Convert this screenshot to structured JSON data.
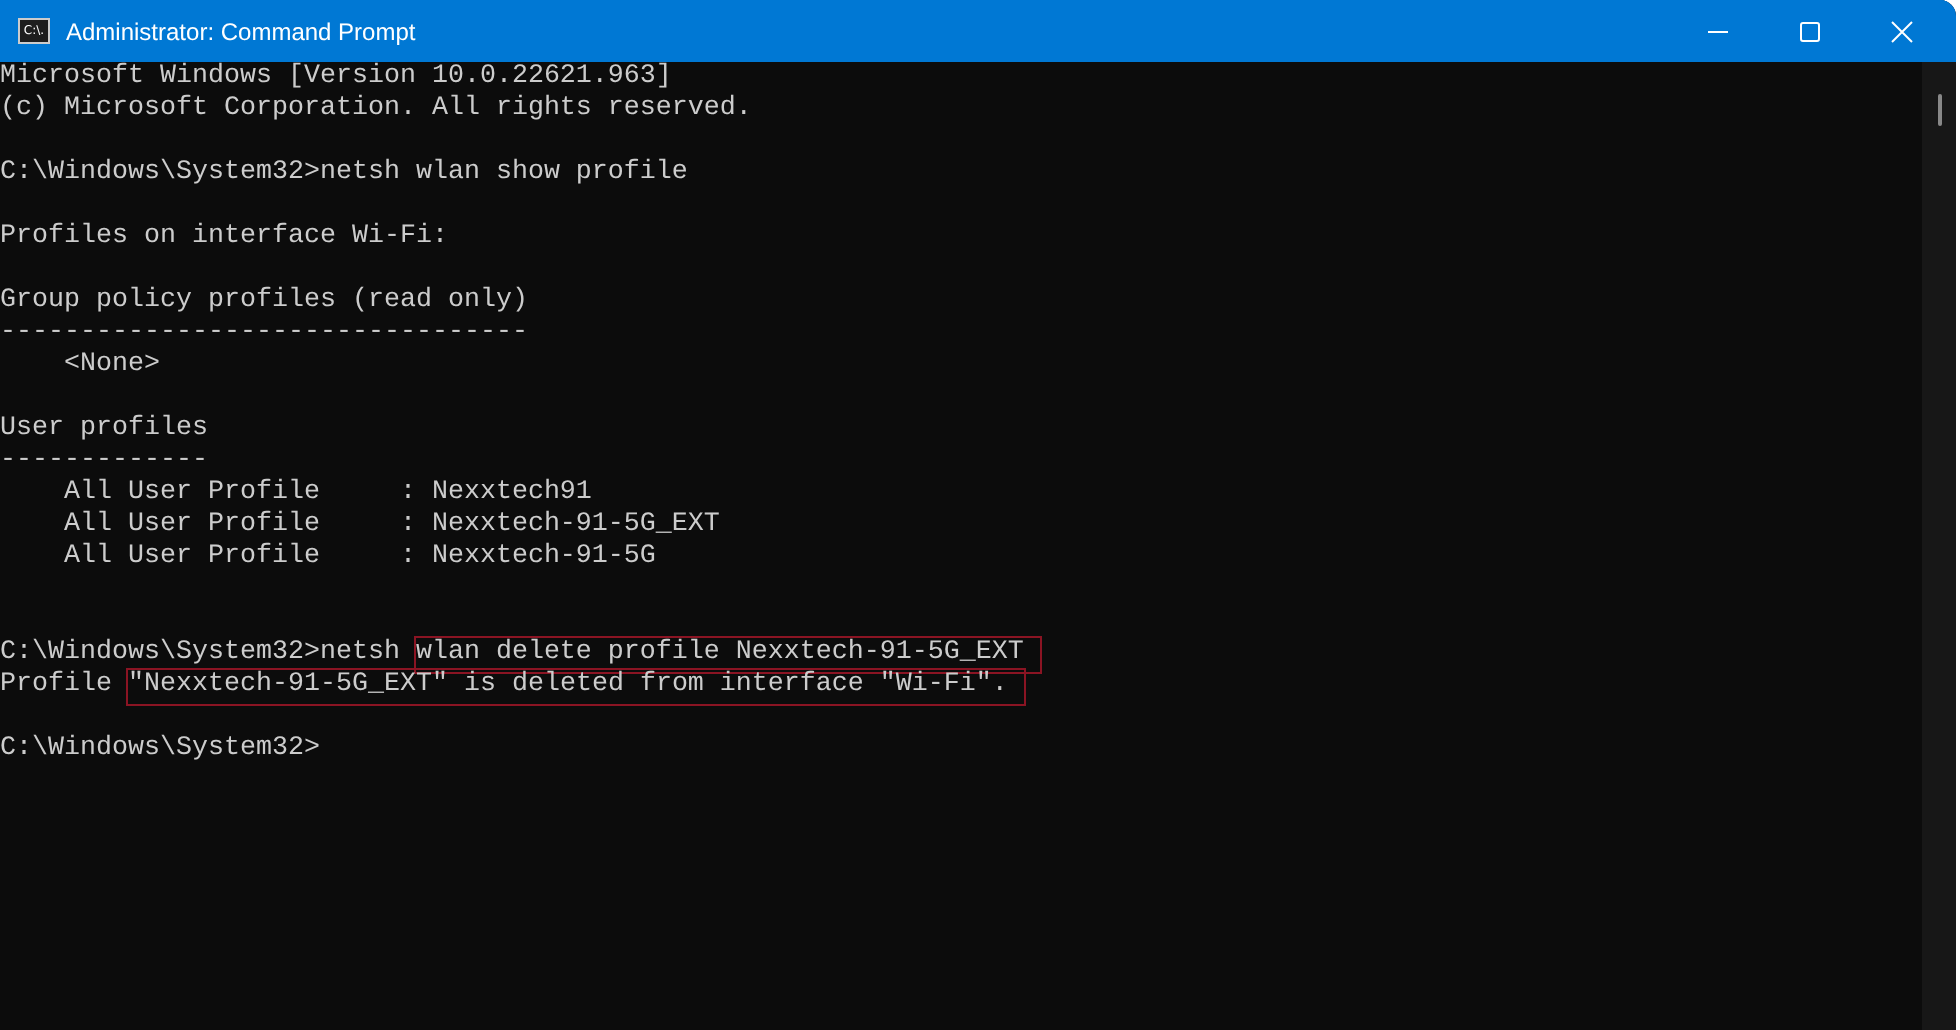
{
  "window": {
    "title": "Administrator: Command Prompt",
    "icon_text": "C:\\."
  },
  "console": {
    "lines": [
      {
        "kind": "text",
        "text": "Microsoft Windows [Version 10.0.22621.963]"
      },
      {
        "kind": "text",
        "text": "(c) Microsoft Corporation. All rights reserved."
      },
      {
        "kind": "blank"
      },
      {
        "kind": "text",
        "text": "C:\\Windows\\System32>netsh wlan show profile"
      },
      {
        "kind": "blank"
      },
      {
        "kind": "text",
        "text": "Profiles on interface Wi-Fi:"
      },
      {
        "kind": "blank"
      },
      {
        "kind": "text",
        "text": "Group policy profiles (read only)"
      },
      {
        "kind": "text",
        "text": "---------------------------------"
      },
      {
        "kind": "text",
        "text": "    <None>"
      },
      {
        "kind": "blank"
      },
      {
        "kind": "text",
        "text": "User profiles"
      },
      {
        "kind": "text",
        "text": "-------------"
      },
      {
        "kind": "text",
        "text": "    All User Profile     : Nexxtech91"
      },
      {
        "kind": "text",
        "text": "    All User Profile     : Nexxtech-91-5G_EXT"
      },
      {
        "kind": "text",
        "text": "    All User Profile     : Nexxtech-91-5G"
      },
      {
        "kind": "blank"
      },
      {
        "kind": "blank"
      },
      {
        "kind": "segments",
        "segments": [
          {
            "text": "C:\\Windows\\System32>netsh ",
            "highlighted": false
          },
          {
            "text": "wlan delete profile Nexxtech-91-5G_EXT",
            "highlighted": true
          }
        ]
      },
      {
        "kind": "segments",
        "segments": [
          {
            "text": "Profile ",
            "highlighted": false
          },
          {
            "text": "\"Nexxtech-91-5G_EXT\" is deleted from interface \"Wi-Fi\".",
            "highlighted": true
          }
        ]
      },
      {
        "kind": "blank"
      },
      {
        "kind": "text",
        "text": "C:\\Windows\\System32>"
      }
    ]
  }
}
